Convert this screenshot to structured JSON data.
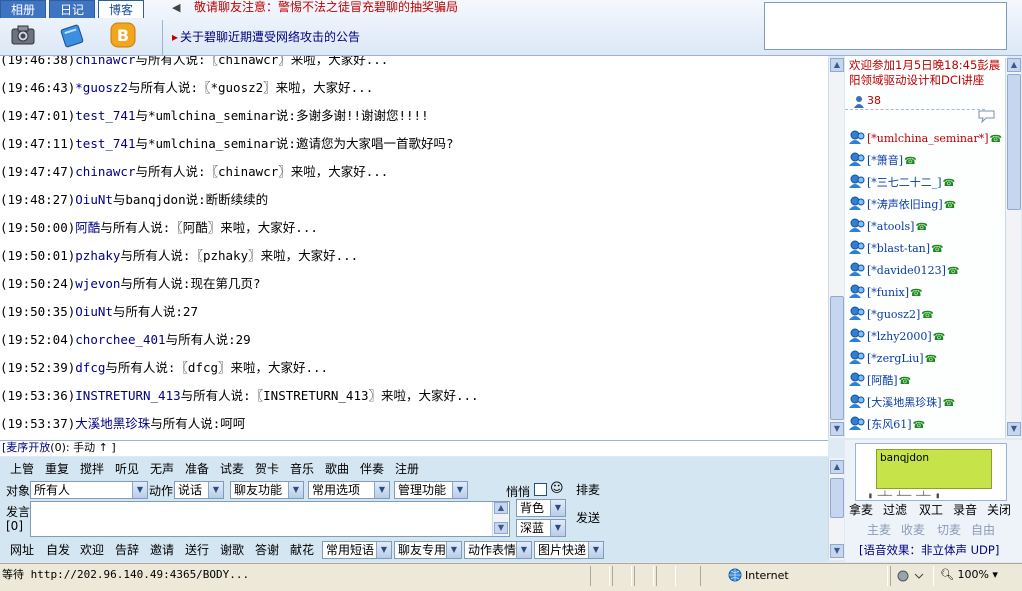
{
  "tabs": [
    "相册",
    "日记",
    "博客"
  ],
  "notice": "敬请聊友注意：警惕不法之徒冒充碧聊的抽奖骗局",
  "announcement": "关于碧聊近期遭受网络攻击的公告",
  "chat": [
    {
      "time": "(19:46:38)",
      "name": "chinawcr",
      "text": "与所有人说:〖chinawcr〗来啦，大家好..."
    },
    {
      "time": "(19:46:43)",
      "name": "*guosz2",
      "text": "与所有人说:〖*guosz2〗来啦，大家好..."
    },
    {
      "time": "(19:47:01)",
      "name": "test_741",
      "text": "与*umlchina_seminar说:多谢多谢!!谢谢您!!!!"
    },
    {
      "time": "(19:47:11)",
      "name": "test_741",
      "text": "与*umlchina_seminar说:邀请您为大家唱一首歌好吗?"
    },
    {
      "time": "(19:47:47)",
      "name": "chinawcr",
      "text": "与所有人说:〖chinawcr〗来啦，大家好..."
    },
    {
      "time": "(19:48:27)",
      "name": "OiuNt",
      "text": "与banqjdon说:断断续续的"
    },
    {
      "time": "(19:50:00)",
      "name": "阿酷",
      "text": "与所有人说:〖阿酷〗来啦，大家好..."
    },
    {
      "time": "(19:50:01)",
      "name": "pzhaky",
      "text": "与所有人说:〖pzhaky〗来啦，大家好..."
    },
    {
      "time": "(19:50:24)",
      "name": "wjevon",
      "text": "与所有人说:现在第几页?"
    },
    {
      "time": "(19:50:35)",
      "name": "OiuNt",
      "text": "与所有人说:27"
    },
    {
      "time": "(19:52:04)",
      "name": "chorchee_401",
      "text": "与所有人说:29"
    },
    {
      "time": "(19:52:39)",
      "name": "dfcg",
      "text": "与所有人说:〖dfcg〗来啦，大家好..."
    },
    {
      "time": "(19:53:36)",
      "name": "INSTRETURN_413",
      "text": "与所有人说:〖INSTRETURN_413〗来啦，大家好..."
    },
    {
      "time": "(19:53:37)",
      "name": "大溪地黑珍珠",
      "text": "与所有人说:呵呵"
    }
  ],
  "event": {
    "text": "欢迎参加1月5日晚18:45彭晨阳领域驱动设计和DCI讲座",
    "count": "38"
  },
  "users": [
    {
      "name": "[*umlchina_seminar*]",
      "red": true
    },
    {
      "name": "[*箫音]",
      "red": false
    },
    {
      "name": "[*三七二十二_]",
      "red": false
    },
    {
      "name": "[*涛声依旧ing]",
      "red": false
    },
    {
      "name": "[*atools]",
      "red": false
    },
    {
      "name": "[*blast-tan]",
      "red": false
    },
    {
      "name": "[*davide0123]",
      "red": false
    },
    {
      "name": "[*funix]",
      "red": false
    },
    {
      "name": "[*guosz2]",
      "red": false
    },
    {
      "name": "[*lzhy2000]",
      "red": false
    },
    {
      "name": "[*zergLiu]",
      "red": false
    },
    {
      "name": "[阿酷]",
      "red": false
    },
    {
      "name": "[大溪地黑珍珠]",
      "red": false
    },
    {
      "name": "[东风61]",
      "red": false
    }
  ],
  "mic": {
    "prefix": "[麦序开放",
    "count_text": "(0): 手动",
    "up": "↑",
    "close": "]"
  },
  "toolbar": [
    "上管",
    "重复",
    "搅拌",
    "听见",
    "无声",
    "准备",
    "试麦",
    "贺卡",
    "音乐",
    "歌曲",
    "伴奏",
    "注册"
  ],
  "controls": {
    "target_label": "对象",
    "target_value": "所有人",
    "action_label": "动作",
    "action_value": "说话",
    "func1": "聊友功能",
    "func2": "常用选项",
    "func3": "管理功能",
    "quiet_label": "悄悄",
    "smile": "☺",
    "scroll_btn": "排麦",
    "speak_label": "发言",
    "speak_count": "[0]",
    "bg_color": "背色",
    "text_color": "深蓝",
    "send": "发送"
  },
  "bottom_links": [
    "网址",
    "自发",
    "欢迎",
    "告辞",
    "邀请",
    "送行",
    "谢歌",
    "答谢",
    "献花"
  ],
  "bottom_selects": [
    "常用短语",
    "聊友专用",
    "动作表情",
    "图片快递"
  ],
  "voice": {
    "speaker": "banqjdon",
    "btns": [
      "拿麦",
      "过滤",
      "双工",
      "录音",
      "关闭"
    ],
    "btns2": [
      "主麦",
      "收麦",
      "切麦",
      "自由"
    ],
    "effect": "[语音效果：非立体声 UDP]"
  },
  "status": {
    "text": "等待 http://202.96.140.49:4365/BODY...",
    "zone": "Internet",
    "zoom": "100%"
  },
  "colors": {
    "accent": "#3f74c0",
    "notice": "#c00000",
    "name": "#000080",
    "speaker_bg": "#c6e34a"
  }
}
